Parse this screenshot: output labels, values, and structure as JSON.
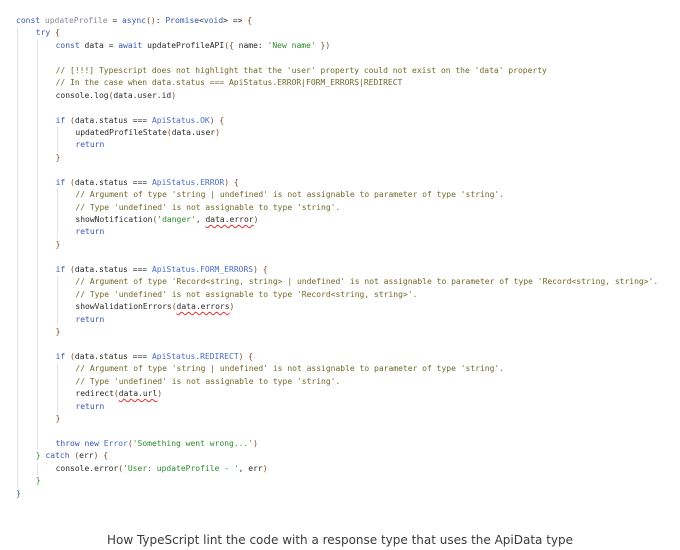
{
  "code_lines": [
    {
      "i": 0,
      "tokens": [
        [
          "kw",
          "const "
        ],
        [
          "dim",
          "updateProfile"
        ],
        [
          "fn",
          " = "
        ],
        [
          "kw",
          "async"
        ],
        [
          "pun",
          "()"
        ],
        [
          "fn",
          ": "
        ],
        [
          "kw",
          "Promise"
        ],
        [
          "fn",
          "<"
        ],
        [
          "kw",
          "void"
        ],
        [
          "fn",
          "> => "
        ],
        [
          "pun",
          "{"
        ]
      ]
    },
    {
      "i": 1,
      "tokens": [
        [
          "kw",
          "try "
        ],
        [
          "pun",
          "{"
        ]
      ]
    },
    {
      "i": 2,
      "tokens": [
        [
          "kw",
          "const "
        ],
        [
          "fn",
          "data = "
        ],
        [
          "kw",
          "await "
        ],
        [
          "fn",
          "updateProfileAPI"
        ],
        [
          "pun",
          "({ "
        ],
        [
          "fn",
          "name: "
        ],
        [
          "str",
          "'New name'"
        ],
        [
          "pun",
          " })"
        ]
      ]
    },
    {
      "i": 2,
      "tokens": []
    },
    {
      "i": 2,
      "tokens": [
        [
          "cm",
          "// [!!!] Typescript does not highlight that the 'user' property could not exist on the 'data' property"
        ]
      ]
    },
    {
      "i": 2,
      "tokens": [
        [
          "cm",
          "// In the case when data.status === ApiStatus.ERROR|FORM_ERRORS|REDIRECT"
        ]
      ]
    },
    {
      "i": 2,
      "tokens": [
        [
          "fn",
          "console.log"
        ],
        [
          "pun",
          "("
        ],
        [
          "fn",
          "data.user.id"
        ],
        [
          "pun",
          ")"
        ]
      ]
    },
    {
      "i": 2,
      "tokens": []
    },
    {
      "i": 2,
      "tokens": [
        [
          "kw",
          "if "
        ],
        [
          "pun",
          "("
        ],
        [
          "fn",
          "data.status === "
        ],
        [
          "ty",
          "ApiStatus.OK"
        ],
        [
          "pun",
          ") {"
        ]
      ]
    },
    {
      "i": 3,
      "tokens": [
        [
          "fn",
          "updatedProfileState"
        ],
        [
          "pun",
          "("
        ],
        [
          "fn",
          "data.user"
        ],
        [
          "pun",
          ")"
        ]
      ]
    },
    {
      "i": 3,
      "tokens": [
        [
          "kw",
          "return"
        ]
      ]
    },
    {
      "i": 2,
      "tokens": [
        [
          "pun",
          "}"
        ]
      ]
    },
    {
      "i": 2,
      "tokens": []
    },
    {
      "i": 2,
      "tokens": [
        [
          "kw",
          "if "
        ],
        [
          "pun",
          "("
        ],
        [
          "fn",
          "data.status === "
        ],
        [
          "ty",
          "ApiStatus.ERROR"
        ],
        [
          "pun",
          ") {"
        ]
      ]
    },
    {
      "i": 3,
      "tokens": [
        [
          "cm",
          "// Argument of type 'string | undefined' is not assignable to parameter of type 'string'."
        ]
      ]
    },
    {
      "i": 3,
      "tokens": [
        [
          "cm",
          "// Type 'undefined' is not assignable to type 'string'."
        ]
      ]
    },
    {
      "i": 3,
      "tokens": [
        [
          "fn",
          "showNotification"
        ],
        [
          "pun",
          "("
        ],
        [
          "str",
          "'danger'"
        ],
        [
          "fn",
          ", "
        ],
        [
          "err",
          "data.error"
        ],
        [
          "pun",
          ")"
        ]
      ]
    },
    {
      "i": 3,
      "tokens": [
        [
          "kw",
          "return"
        ]
      ]
    },
    {
      "i": 2,
      "tokens": [
        [
          "pun",
          "}"
        ]
      ]
    },
    {
      "i": 2,
      "tokens": []
    },
    {
      "i": 2,
      "tokens": [
        [
          "kw",
          "if "
        ],
        [
          "pun",
          "("
        ],
        [
          "fn",
          "data.status === "
        ],
        [
          "ty",
          "ApiStatus.FORM_ERRORS"
        ],
        [
          "pun",
          ") {"
        ]
      ]
    },
    {
      "i": 3,
      "tokens": [
        [
          "cm",
          "// Argument of type 'Record<string, string> | undefined' is not assignable to parameter of type 'Record<string, string>'."
        ]
      ]
    },
    {
      "i": 3,
      "tokens": [
        [
          "cm",
          "// Type 'undefined' is not assignable to type 'Record<string, string>'."
        ]
      ]
    },
    {
      "i": 3,
      "tokens": [
        [
          "fn",
          "showValidationErrors"
        ],
        [
          "pun",
          "("
        ],
        [
          "err",
          "data.errors"
        ],
        [
          "pun",
          ")"
        ]
      ]
    },
    {
      "i": 3,
      "tokens": [
        [
          "kw",
          "return"
        ]
      ]
    },
    {
      "i": 2,
      "tokens": [
        [
          "pun",
          "}"
        ]
      ]
    },
    {
      "i": 2,
      "tokens": []
    },
    {
      "i": 2,
      "tokens": [
        [
          "kw",
          "if "
        ],
        [
          "pun",
          "("
        ],
        [
          "fn",
          "data.status === "
        ],
        [
          "ty",
          "ApiStatus.REDIRECT"
        ],
        [
          "pun",
          ") {"
        ]
      ]
    },
    {
      "i": 3,
      "tokens": [
        [
          "cm",
          "// Argument of type 'string | undefined' is not assignable to parameter of type 'string'."
        ]
      ]
    },
    {
      "i": 3,
      "tokens": [
        [
          "cm",
          "// Type 'undefined' is not assignable to type 'string'."
        ]
      ]
    },
    {
      "i": 3,
      "tokens": [
        [
          "fn",
          "redirect"
        ],
        [
          "pun",
          "("
        ],
        [
          "err",
          "data.url"
        ],
        [
          "pun",
          ")"
        ]
      ]
    },
    {
      "i": 3,
      "tokens": [
        [
          "kw",
          "return"
        ]
      ]
    },
    {
      "i": 2,
      "tokens": [
        [
          "pun",
          "}"
        ]
      ]
    },
    {
      "i": 2,
      "tokens": []
    },
    {
      "i": 2,
      "tokens": [
        [
          "kw",
          "throw new "
        ],
        [
          "ty",
          "Error"
        ],
        [
          "pun",
          "("
        ],
        [
          "str",
          "'Something went wrong...'"
        ],
        [
          "pun",
          ")"
        ]
      ]
    },
    {
      "i": 1,
      "tokens": [
        [
          "str",
          "} "
        ],
        [
          "kw",
          "catch "
        ],
        [
          "pun",
          "("
        ],
        [
          "fn",
          "err"
        ],
        [
          "pun",
          ") {"
        ]
      ]
    },
    {
      "i": 2,
      "tokens": [
        [
          "fn",
          "console.error"
        ],
        [
          "pun",
          "("
        ],
        [
          "str",
          "'User: updateProfile - '"
        ],
        [
          "fn",
          ", err"
        ],
        [
          "pun",
          ")"
        ]
      ]
    },
    {
      "i": 1,
      "tokens": [
        [
          "str",
          "}"
        ]
      ]
    },
    {
      "i": 0,
      "tokens": [
        [
          "kw",
          "}"
        ]
      ]
    }
  ],
  "caption": "How TypeScript lint the code with a response type that uses the ApiData type"
}
